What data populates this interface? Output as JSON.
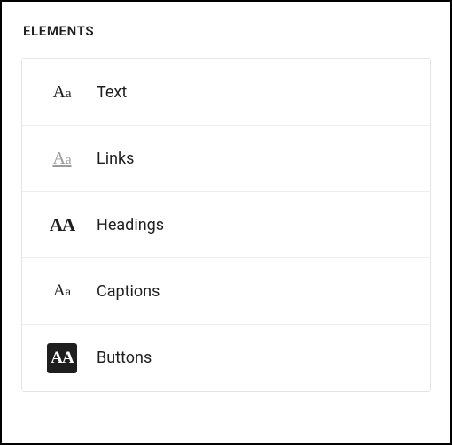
{
  "section_title": "ELEMENTS",
  "items": [
    {
      "id": "text",
      "label": "Text"
    },
    {
      "id": "links",
      "label": "Links"
    },
    {
      "id": "headings",
      "label": "Headings"
    },
    {
      "id": "captions",
      "label": "Captions"
    },
    {
      "id": "buttons",
      "label": "Buttons"
    }
  ]
}
